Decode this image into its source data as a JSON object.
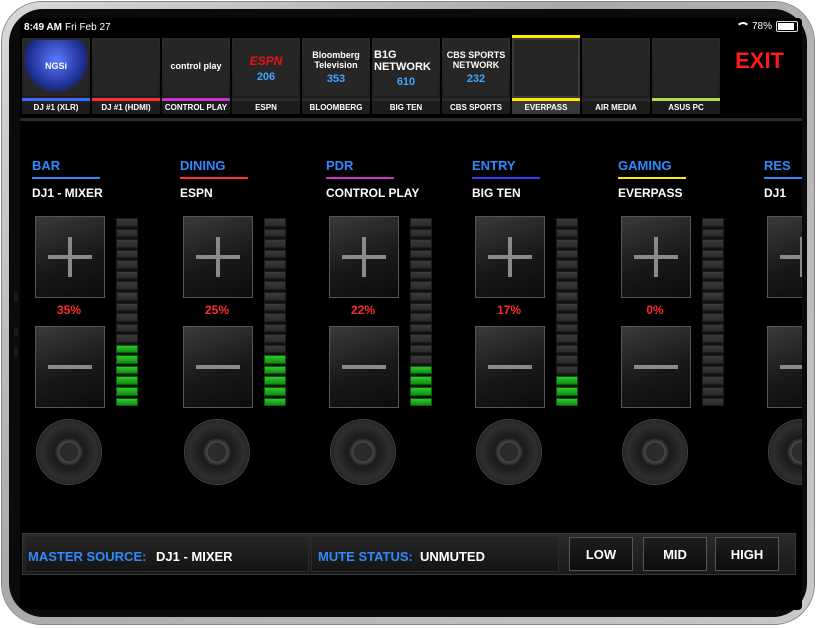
{
  "status": {
    "time": "8:49 AM",
    "date": "Fri Feb 27",
    "battery": "78%"
  },
  "sources": [
    {
      "label": "DJ #1 (XLR)",
      "logo_text": "NGSi",
      "channel": "",
      "color": "#3a6cff",
      "icon": "dj-mixer-icon"
    },
    {
      "label": "DJ #1 (HDMI)",
      "logo_text": "",
      "channel": "",
      "color": "#ff3030",
      "icon": "hdmi-plug-icon"
    },
    {
      "label": "CONTROL PLAY",
      "logo_text": "control play",
      "channel": "",
      "color": "#cc33cc",
      "icon": "control-play-logo"
    },
    {
      "label": "ESPN",
      "logo_text": "ESPN",
      "channel": "206",
      "color": "#2a2a2a",
      "icon": "espn-logo"
    },
    {
      "label": "BLOOMBERG",
      "logo_text": "Bloomberg Television",
      "channel": "353",
      "color": "#2a2a2a",
      "icon": "bloomberg-logo"
    },
    {
      "label": "BIG TEN",
      "logo_text": "B1G NETWORK",
      "channel": "610",
      "color": "#2a2a2a",
      "icon": "big-ten-logo"
    },
    {
      "label": "CBS SPORTS",
      "logo_text": "CBS SPORTS NETWORK",
      "channel": "232",
      "color": "#2a2a2a",
      "icon": "cbs-sports-logo"
    },
    {
      "label": "EVERPASS",
      "logo_text": "",
      "channel": "",
      "color": "#ffeb00",
      "icon": "everpass-logo"
    },
    {
      "label": "AIR MEDIA",
      "logo_text": "",
      "channel": "",
      "color": "#2a2a2a",
      "icon": "air-media-icon"
    },
    {
      "label": "ASUS PC",
      "logo_text": "",
      "channel": "",
      "color": "#aadd44",
      "icon": "laptop-icon"
    }
  ],
  "exit_label": "EXIT",
  "zones": [
    {
      "name": "BAR",
      "color": "#2e8bff",
      "source": "DJ1 - MIXER",
      "volume": "35%",
      "meter_level": 0.35
    },
    {
      "name": "DINING",
      "color": "#2e8bff",
      "line_color": "#ff3030",
      "source": "ESPN",
      "volume": "25%",
      "meter_level": 0.25
    },
    {
      "name": "PDR",
      "color": "#2e8bff",
      "line_color": "#cc33cc",
      "source": "CONTROL PLAY",
      "volume": "22%",
      "meter_level": 0.22
    },
    {
      "name": "ENTRY",
      "color": "#2e8bff",
      "line_color": "#3a3aff",
      "source": "BIG TEN",
      "volume": "17%",
      "meter_level": 0.17
    },
    {
      "name": "GAMING",
      "color": "#2e8bff",
      "line_color": "#ffeb00",
      "source": "EVERPASS",
      "volume": "0%",
      "meter_level": 0.0
    },
    {
      "name": "RES",
      "color": "#2e8bff",
      "line_color": "#2e8bff",
      "source": "DJ1",
      "volume": "",
      "meter_level": 0.0
    }
  ],
  "bottom": {
    "master_label": "MASTER SOURCE:",
    "master_value": "DJ1 - MIXER",
    "mute_label": "MUTE STATUS:",
    "mute_value": "UNMUTED",
    "levels": [
      "LOW",
      "MID",
      "HIGH"
    ]
  }
}
